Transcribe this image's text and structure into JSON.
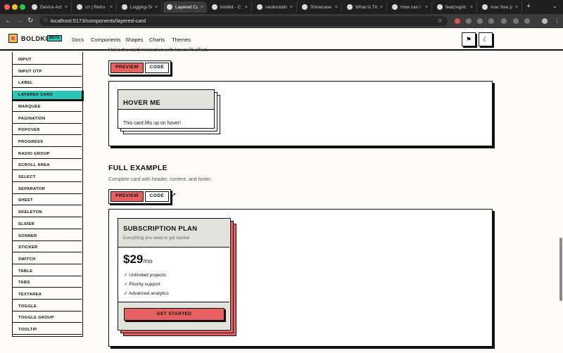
{
  "browser": {
    "tabs": [
      {
        "title": "Device Acti",
        "icon": "github-icon"
      },
      {
        "title": "cn | Retro",
        "icon": "github-icon"
      },
      {
        "title": "Logging-Sl",
        "icon": "github-icon"
      },
      {
        "title": "Layered Ca",
        "icon": "page-icon",
        "active": true
      },
      {
        "title": "boldkit - C",
        "icon": "vercel-icon"
      },
      {
        "title": "neobrutalis",
        "icon": "github-icon"
      },
      {
        "title": "Showcase",
        "icon": "notion-icon"
      },
      {
        "title": "What Is Th",
        "icon": "page-icon"
      },
      {
        "title": "How can I i",
        "icon": "page-icon"
      },
      {
        "title": "feat(regist",
        "icon": "page-icon"
      },
      {
        "title": "mac free p",
        "icon": "google-icon"
      }
    ],
    "url": "localhost:5173/components/layered-card"
  },
  "header": {
    "brand": "BOLDKIT",
    "badge": "BETA",
    "nav": [
      "Docs",
      "Components",
      "Shapes",
      "Charts",
      "Themes"
    ]
  },
  "sidebar": {
    "items": [
      "INPUT",
      "INPUT OTP",
      "LABEL",
      "LAYERED CARD",
      "MARQUEE",
      "PAGINATION",
      "POPOVER",
      "PROGRESS",
      "RADIO GROUP",
      "SCROLL AREA",
      "SELECT",
      "SEPARATOR",
      "SHEET",
      "SKELETON",
      "SLIDER",
      "SONNER",
      "STICKER",
      "SWITCH",
      "TABLE",
      "TABS",
      "TEXTAREA",
      "TOGGLE",
      "TOGGLE GROUP",
      "TOOLTIP"
    ],
    "active": "LAYERED CARD"
  },
  "hover_section": {
    "desc": "Make the card interactive with hover lift effect.",
    "tabs": {
      "preview": "PREVIEW",
      "code": "CODE"
    },
    "card_title": "HOVER ME",
    "card_body": "This card lifts up on hover!"
  },
  "full_section": {
    "title": "FULL EXAMPLE",
    "desc": "Complete card with header, content, and footer.",
    "tabs": {
      "preview": "PREVIEW",
      "code": "CODE"
    },
    "card_title": "SUBSCRIPTION PLAN",
    "card_subtitle": "Everything you need to get started",
    "price": "$29",
    "per": "/mo",
    "features": [
      "✓ Unlimited projects",
      "✓ Priority support",
      "✓ Advanced analytics"
    ],
    "cta": "GET STARTED"
  },
  "colors": {
    "accent_red": "#e86161",
    "accent_teal": "#2ec4b6",
    "ink": "#111111"
  }
}
